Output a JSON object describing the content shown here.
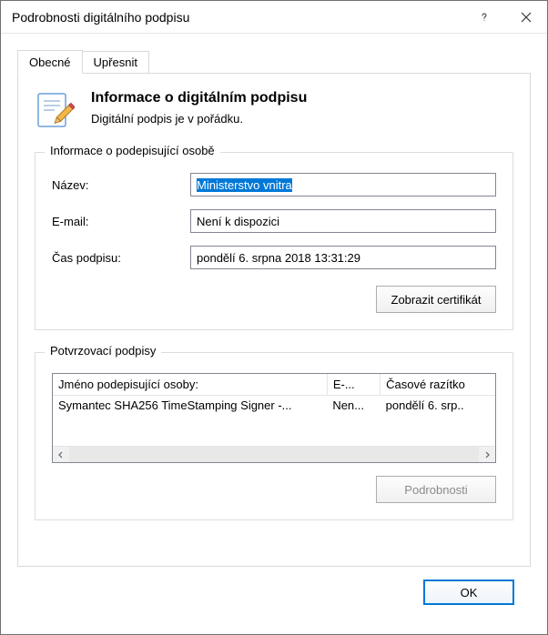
{
  "window": {
    "title": "Podrobnosti digitálního podpisu"
  },
  "tabs": {
    "general": "Obecné",
    "advanced": "Upřesnit"
  },
  "header": {
    "title": "Informace o digitálním podpisu",
    "subtitle": "Digitální podpis je v pořádku."
  },
  "signer_group": {
    "legend": "Informace o podepisující osobě",
    "name_label": "Název:",
    "name_value": "Ministerstvo vnitra",
    "email_label": "E-mail:",
    "email_value": "Není k dispozici",
    "time_label": "Čas podpisu:",
    "time_value": "pondělí 6. srpna 2018 13:31:29",
    "cert_button": "Zobrazit certifikát"
  },
  "counter_group": {
    "legend": "Potvrzovací podpisy",
    "columns": {
      "name": "Jméno podepisující osoby:",
      "email": "E-...",
      "timestamp": "Časové razítko"
    },
    "row": {
      "name": "Symantec SHA256 TimeStamping Signer -...",
      "email": "Nen...",
      "timestamp": "pondělí 6. srp.."
    },
    "details_button": "Podrobnosti"
  },
  "ok_button": "OK"
}
